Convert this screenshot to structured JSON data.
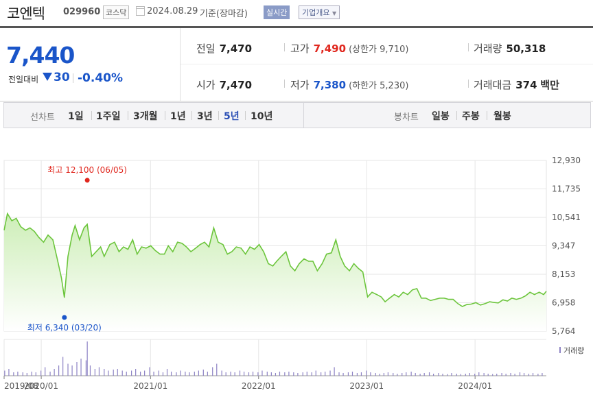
{
  "header": {
    "name": "코엔텍",
    "code": "029960",
    "market": "코스닥",
    "date": "2024.08.29",
    "basis": "기준(장마감)",
    "realtime": "실시간",
    "overview": "기업개요"
  },
  "quote": {
    "current": "7,440",
    "compare_label": "전일대비",
    "change": "30",
    "change_pct": "-0.40%",
    "prev_label": "전일",
    "prev": "7,470",
    "high_label": "고가",
    "high": "7,490",
    "upper_limit": "(상한가 9,710)",
    "volume_label": "거래량",
    "volume": "50,318",
    "open_label": "시가",
    "open": "7,470",
    "low_label": "저가",
    "low": "7,380",
    "lower_limit": "(하한가 5,230)",
    "amount_label": "거래대금",
    "amount": "374",
    "amount_unit": "백만"
  },
  "line_tabs": {
    "title": "선차트",
    "items": [
      "1일",
      "1주일",
      "3개월",
      "1년",
      "3년",
      "5년",
      "10년"
    ],
    "active": "5년"
  },
  "candle_tabs": {
    "title": "봉차트",
    "items": [
      "일봉",
      "주봉",
      "월봉"
    ]
  },
  "colors": {
    "line": "#6cc53c",
    "fill_top": "#cdeeb7",
    "up": "#e0271e",
    "down": "#1a55c9",
    "volume": "#8c82c4"
  },
  "chart_data": {
    "type": "area",
    "yticks": [
      "12,930",
      "11,735",
      "10,541",
      "9,347",
      "8,153",
      "6,958",
      "5,764"
    ],
    "ylim": [
      5764,
      12930
    ],
    "xlim": [
      "2019-08-30",
      "2024-08-29"
    ],
    "xtick_labels": [
      "2019/08",
      "2020/01",
      "2021/01",
      "2022/01",
      "2023/01",
      "2024/01"
    ],
    "xtick_dates": [
      "2019-08-30",
      "2020-01-02",
      "2021-01-04",
      "2022-01-03",
      "2023-01-02",
      "2024-01-02"
    ],
    "max_label": "최고 12,100 (06/05)",
    "max_point": {
      "date": "2020-06-05",
      "value": 12100
    },
    "min_label": "최저 6,340 (03/20)",
    "min_point": {
      "date": "2020-03-20",
      "value": 6340
    },
    "volume_legend": "거래량",
    "price": {
      "x": [
        "2019-08-30",
        "2019-09-10",
        "2019-09-25",
        "2019-10-10",
        "2019-10-25",
        "2019-11-10",
        "2019-11-25",
        "2019-12-10",
        "2019-12-25",
        "2020-01-10",
        "2020-01-25",
        "2020-02-10",
        "2020-02-25",
        "2020-03-10",
        "2020-03-20",
        "2020-04-01",
        "2020-04-15",
        "2020-04-25",
        "2020-05-10",
        "2020-05-25",
        "2020-06-05",
        "2020-06-20",
        "2020-07-05",
        "2020-07-20",
        "2020-08-01",
        "2020-08-20",
        "2020-09-05",
        "2020-09-20",
        "2020-10-05",
        "2020-10-20",
        "2020-11-05",
        "2020-11-20",
        "2020-12-05",
        "2020-12-20",
        "2021-01-05",
        "2021-01-20",
        "2021-02-05",
        "2021-02-20",
        "2021-03-05",
        "2021-03-20",
        "2021-04-05",
        "2021-04-20",
        "2021-05-05",
        "2021-05-20",
        "2021-06-05",
        "2021-06-20",
        "2021-07-05",
        "2021-07-20",
        "2021-08-05",
        "2021-08-20",
        "2021-09-05",
        "2021-09-20",
        "2021-10-05",
        "2021-10-20",
        "2021-11-05",
        "2021-11-20",
        "2021-12-05",
        "2021-12-20",
        "2022-01-05",
        "2022-01-20",
        "2022-02-05",
        "2022-02-20",
        "2022-03-05",
        "2022-03-20",
        "2022-04-05",
        "2022-04-20",
        "2022-05-05",
        "2022-05-20",
        "2022-06-05",
        "2022-06-20",
        "2022-07-05",
        "2022-07-20",
        "2022-08-05",
        "2022-08-20",
        "2022-09-05",
        "2022-09-20",
        "2022-10-05",
        "2022-10-20",
        "2022-11-05",
        "2022-11-20",
        "2022-12-05",
        "2022-12-20",
        "2023-01-05",
        "2023-01-20",
        "2023-02-05",
        "2023-02-20",
        "2023-03-05",
        "2023-03-20",
        "2023-04-05",
        "2023-04-20",
        "2023-05-05",
        "2023-05-20",
        "2023-06-05",
        "2023-06-20",
        "2023-07-05",
        "2023-07-20",
        "2023-08-05",
        "2023-08-20",
        "2023-09-05",
        "2023-09-20",
        "2023-10-05",
        "2023-10-20",
        "2023-11-05",
        "2023-11-20",
        "2023-12-05",
        "2023-12-20",
        "2024-01-05",
        "2024-01-20",
        "2024-02-05",
        "2024-02-20",
        "2024-03-05",
        "2024-03-20",
        "2024-04-05",
        "2024-04-20",
        "2024-05-05",
        "2024-05-20",
        "2024-06-05",
        "2024-06-20",
        "2024-07-05",
        "2024-07-20",
        "2024-08-05",
        "2024-08-20",
        "2024-08-29"
      ],
      "values": [
        10000,
        10700,
        10400,
        10500,
        10150,
        10000,
        10100,
        9950,
        9700,
        9500,
        9800,
        9600,
        8800,
        8000,
        7170,
        8900,
        9800,
        10200,
        9600,
        10100,
        10250,
        8900,
        9100,
        9300,
        8900,
        9400,
        9500,
        9100,
        9300,
        9200,
        9600,
        9000,
        9300,
        9250,
        9350,
        9150,
        9000,
        9000,
        9350,
        9100,
        9500,
        9450,
        9300,
        9100,
        9250,
        9400,
        9500,
        9300,
        10100,
        9500,
        9400,
        9000,
        9100,
        9300,
        9250,
        9000,
        9300,
        9200,
        9400,
        9100,
        8600,
        8500,
        8700,
        8900,
        9100,
        8500,
        8300,
        8600,
        8800,
        8700,
        8700,
        8300,
        8600,
        9000,
        9050,
        9600,
        8900,
        8500,
        8300,
        8600,
        8400,
        8250,
        7200,
        7400,
        7300,
        7200,
        7000,
        7150,
        7300,
        7200,
        7400,
        7300,
        7500,
        7550,
        7150,
        7150,
        7050,
        7100,
        7150,
        7150,
        7100,
        7100,
        6920,
        6800,
        6880,
        6900,
        6960,
        6860,
        6920,
        7000,
        6970,
        6950,
        7080,
        7030,
        7150,
        7100,
        7150,
        7250,
        7400,
        7300,
        7400,
        7300,
        7440
      ]
    },
    "volume": {
      "x": [
        "2019-09-01",
        "2019-09-15",
        "2019-10-01",
        "2019-10-15",
        "2019-11-01",
        "2019-11-15",
        "2019-12-01",
        "2019-12-15",
        "2020-01-01",
        "2020-01-15",
        "2020-02-01",
        "2020-02-15",
        "2020-03-01",
        "2020-03-15",
        "2020-04-01",
        "2020-04-15",
        "2020-05-01",
        "2020-05-15",
        "2020-06-01",
        "2020-06-05",
        "2020-06-15",
        "2020-07-01",
        "2020-07-15",
        "2020-08-01",
        "2020-08-15",
        "2020-09-01",
        "2020-09-15",
        "2020-10-01",
        "2020-10-15",
        "2020-11-01",
        "2020-11-15",
        "2020-12-01",
        "2020-12-15",
        "2021-01-01",
        "2021-01-15",
        "2021-02-01",
        "2021-02-15",
        "2021-03-01",
        "2021-03-15",
        "2021-04-01",
        "2021-04-15",
        "2021-05-01",
        "2021-05-15",
        "2021-06-01",
        "2021-06-15",
        "2021-07-01",
        "2021-07-15",
        "2021-08-01",
        "2021-08-15",
        "2021-09-01",
        "2021-09-15",
        "2021-10-01",
        "2021-10-15",
        "2021-11-01",
        "2021-11-15",
        "2021-12-01",
        "2021-12-15",
        "2022-01-01",
        "2022-01-15",
        "2022-02-01",
        "2022-02-15",
        "2022-03-01",
        "2022-03-15",
        "2022-04-01",
        "2022-04-15",
        "2022-05-01",
        "2022-05-15",
        "2022-06-01",
        "2022-06-15",
        "2022-07-01",
        "2022-07-15",
        "2022-08-01",
        "2022-08-15",
        "2022-09-01",
        "2022-09-15",
        "2022-10-01",
        "2022-10-15",
        "2022-11-01",
        "2022-11-15",
        "2022-12-01",
        "2022-12-15",
        "2023-01-01",
        "2023-01-15",
        "2023-02-01",
        "2023-02-15",
        "2023-03-01",
        "2023-03-15",
        "2023-04-01",
        "2023-04-15",
        "2023-05-01",
        "2023-05-15",
        "2023-06-01",
        "2023-06-15",
        "2023-07-01",
        "2023-07-15",
        "2023-08-01",
        "2023-08-15",
        "2023-09-01",
        "2023-09-15",
        "2023-10-01",
        "2023-10-15",
        "2023-11-01",
        "2023-11-15",
        "2023-12-01",
        "2023-12-15",
        "2024-01-01",
        "2024-01-15",
        "2024-02-01",
        "2024-02-15",
        "2024-03-01",
        "2024-03-15",
        "2024-04-01",
        "2024-04-15",
        "2024-05-01",
        "2024-05-15",
        "2024-06-01",
        "2024-06-15",
        "2024-07-01",
        "2024-07-15",
        "2024-08-01",
        "2024-08-15"
      ],
      "values": [
        0.15,
        0.2,
        0.1,
        0.12,
        0.1,
        0.08,
        0.12,
        0.1,
        0.15,
        0.25,
        0.12,
        0.2,
        0.3,
        0.55,
        0.35,
        0.3,
        0.4,
        0.5,
        0.45,
        1.0,
        0.3,
        0.2,
        0.25,
        0.2,
        0.15,
        0.18,
        0.2,
        0.15,
        0.12,
        0.15,
        0.2,
        0.12,
        0.15,
        0.25,
        0.12,
        0.15,
        0.1,
        0.2,
        0.12,
        0.1,
        0.15,
        0.12,
        0.1,
        0.12,
        0.15,
        0.18,
        0.12,
        0.25,
        0.35,
        0.15,
        0.1,
        0.12,
        0.1,
        0.15,
        0.12,
        0.1,
        0.12,
        0.1,
        0.15,
        0.12,
        0.1,
        0.08,
        0.12,
        0.1,
        0.12,
        0.1,
        0.08,
        0.1,
        0.12,
        0.1,
        0.15,
        0.1,
        0.12,
        0.15,
        0.25,
        0.1,
        0.08,
        0.1,
        0.12,
        0.08,
        0.1,
        0.15,
        0.1,
        0.08,
        0.06,
        0.08,
        0.1,
        0.08,
        0.06,
        0.08,
        0.1,
        0.12,
        0.08,
        0.06,
        0.08,
        0.1,
        0.06,
        0.08,
        0.06,
        0.05,
        0.08,
        0.06,
        0.05,
        0.06,
        0.08,
        0.06,
        0.1,
        0.08,
        0.06,
        0.05,
        0.06,
        0.08,
        0.06,
        0.08,
        0.06,
        0.1,
        0.08,
        0.06,
        0.08,
        0.06,
        0.08
      ]
    }
  }
}
